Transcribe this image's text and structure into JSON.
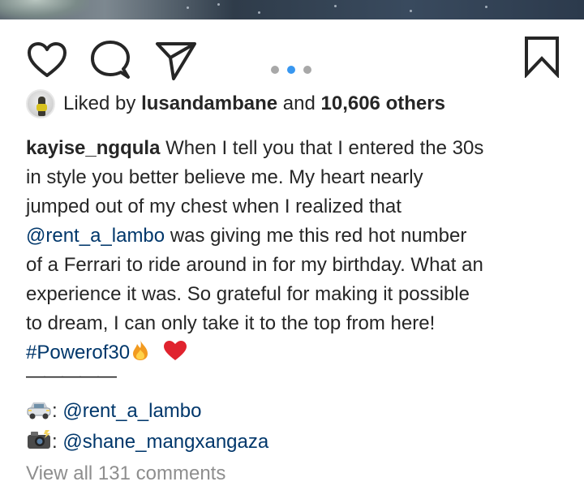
{
  "post": {
    "actions": {
      "like_icon": "heart-outline-icon",
      "comment_icon": "speech-bubble-icon",
      "share_icon": "paper-plane-icon",
      "save_icon": "bookmark-outline-icon"
    },
    "carousel": {
      "count": 3,
      "active_index": 2,
      "active_color": "#3897f0",
      "inactive_color": "#a8a8a8"
    },
    "likes": {
      "prefix": "Liked by",
      "user": "lusandambane",
      "connector": "and",
      "others": "10,606 others"
    },
    "caption": {
      "username": "kayise_ngqula",
      "line1": "When I tell you that I entered the 30s",
      "line2": "in style you better believe me. My heart nearly",
      "line3": "jumped out of my chest when I realized that",
      "line4_mention": "@rent_a_lambo",
      "line4_rest": "was giving me this red hot number",
      "line5": "of a Ferrari to ride around in for my birthday. What an",
      "line6": "experience it was. So grateful for making it possible",
      "line7": "to dream, I can only take it to the top from here!",
      "hashtag": "#Powerof30",
      "divider": "—————"
    },
    "credits": [
      {
        "icon": "car-emoji-icon",
        "separator": ":",
        "handle": "@rent_a_lambo"
      },
      {
        "icon": "camera-flash-emoji-icon",
        "separator": ":",
        "handle": "@shane_mangxangaza"
      }
    ],
    "comments": {
      "view_all": "View all 131 comments"
    },
    "colors": {
      "text": "#262626",
      "link": "#00376b",
      "muted": "#8e8e8e",
      "heart_red": "#e0232e",
      "fire_orange": "#f29a1f"
    }
  }
}
